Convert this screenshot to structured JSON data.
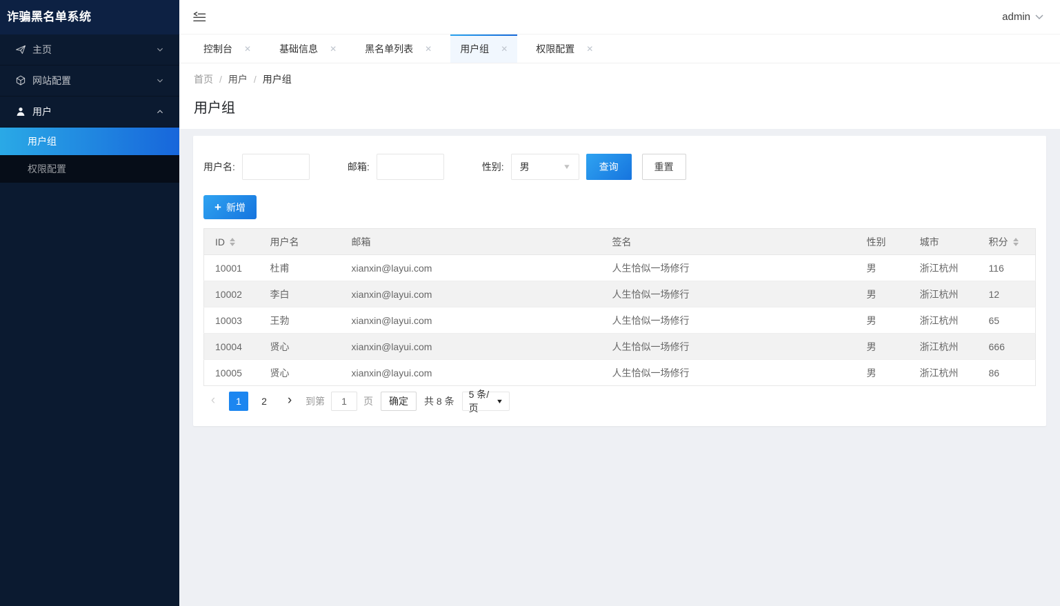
{
  "app_title": "诈骗黑名单系统",
  "colors": {
    "accent": "#1e9fff",
    "accent_gradient_start": "#2aa3ef",
    "accent_gradient_end": "#1467d8",
    "sidebar_bg": "#0b1a30",
    "sidebar_header_bg": "#0d2143",
    "submenu_bg": "#060d18",
    "body_bg": "#eef0f4",
    "stripe": "#f2f2f2",
    "border": "#e6e6e6"
  },
  "sidebar": {
    "title": "诈骗黑名单系统",
    "items": [
      {
        "label": "主页",
        "icon": "paper-plane-icon",
        "state": "collapsed"
      },
      {
        "label": "网站配置",
        "icon": "cube-icon",
        "state": "collapsed"
      },
      {
        "label": "用户",
        "icon": "user-icon",
        "state": "expanded",
        "children": [
          {
            "label": "用户组",
            "active": true
          },
          {
            "label": "权限配置",
            "active": false
          }
        ]
      }
    ]
  },
  "header": {
    "user_label": "admin"
  },
  "tabs": [
    {
      "label": "控制台",
      "active": false
    },
    {
      "label": "基础信息",
      "active": false
    },
    {
      "label": "黑名单列表",
      "active": false
    },
    {
      "label": "用户组",
      "active": true
    },
    {
      "label": "权限配置",
      "active": false
    }
  ],
  "breadcrumb": {
    "items": [
      "首页",
      "用户",
      "用户组"
    ],
    "separator": "/"
  },
  "page": {
    "title": "用户组"
  },
  "filters": {
    "username_label": "用户名:",
    "username_value": "",
    "email_label": "邮箱:",
    "email_value": "",
    "gender_label": "性别:",
    "gender_value": "男",
    "search_label": "查询",
    "reset_label": "重置",
    "add_label": "新增",
    "add_plus": "+"
  },
  "table": {
    "columns": [
      "ID",
      "用户名",
      "邮箱",
      "签名",
      "性别",
      "城市",
      "积分"
    ],
    "sortable_columns": [
      "ID",
      "积分"
    ],
    "rows": [
      [
        "10001",
        "杜甫",
        "xianxin@layui.com",
        "人生恰似一场修行",
        "男",
        "浙江杭州",
        "116"
      ],
      [
        "10002",
        "李白",
        "xianxin@layui.com",
        "人生恰似一场修行",
        "男",
        "浙江杭州",
        "12"
      ],
      [
        "10003",
        "王勃",
        "xianxin@layui.com",
        "人生恰似一场修行",
        "男",
        "浙江杭州",
        "65"
      ],
      [
        "10004",
        "贤心",
        "xianxin@layui.com",
        "人生恰似一场修行",
        "男",
        "浙江杭州",
        "666"
      ],
      [
        "10005",
        "贤心",
        "xianxin@layui.com",
        "人生恰似一场修行",
        "男",
        "浙江杭州",
        "86"
      ]
    ]
  },
  "pagination": {
    "prev": "‹",
    "next": "›",
    "pages": [
      "1",
      "2"
    ],
    "current_page": "1",
    "goto_label": "到第",
    "goto_value": "1",
    "page_unit": "页",
    "confirm_label": "确定",
    "total_label": "共 8 条",
    "per_page": "5 条/页"
  }
}
